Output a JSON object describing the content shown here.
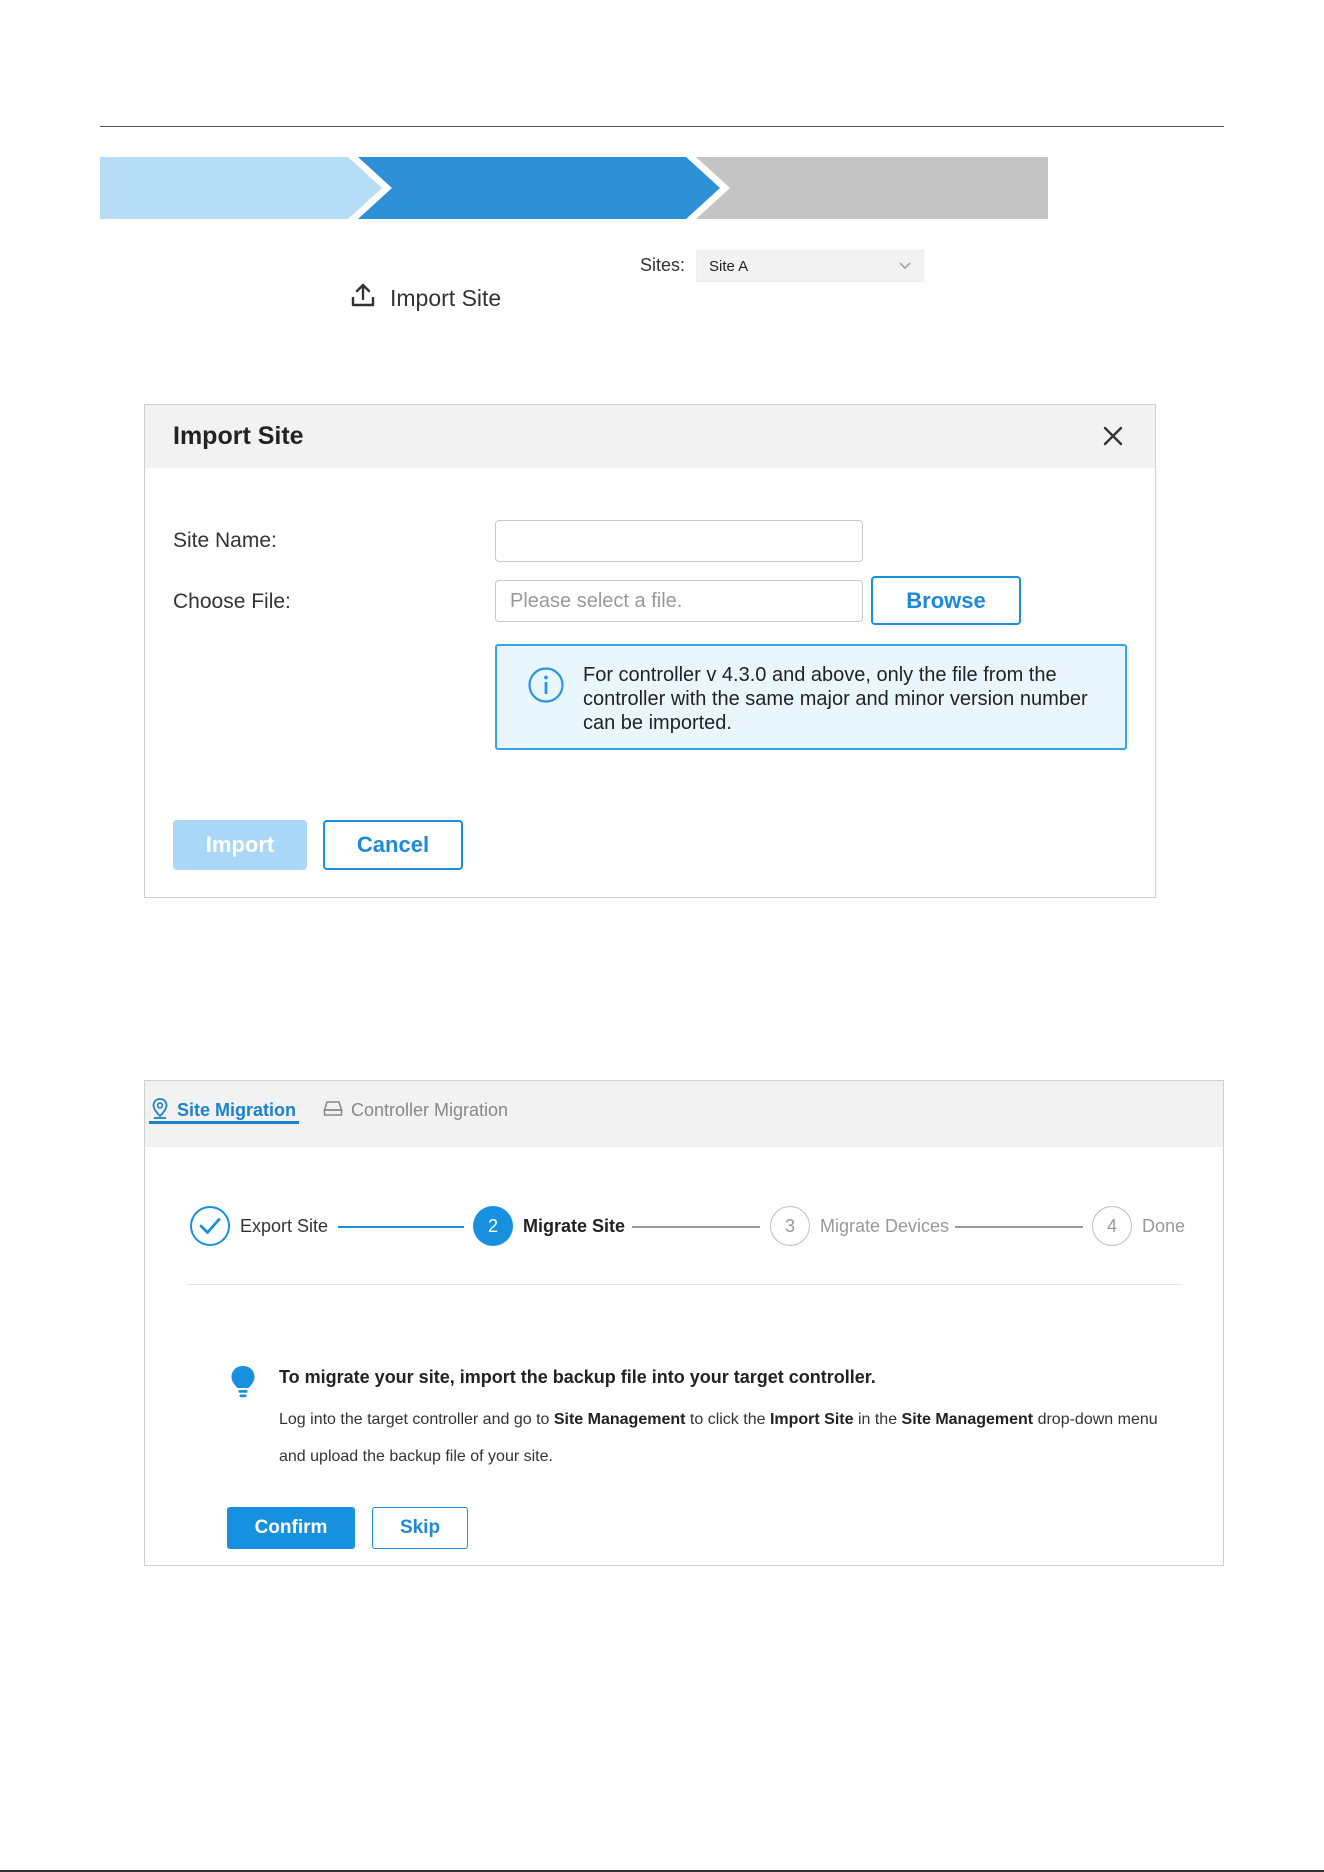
{
  "colors": {
    "primary": "#1890e0",
    "step_light": "#b7dcf6",
    "step_active": "#2d8fd6",
    "step_pending": "#c4c4c4",
    "info_bg": "#eaf6fd",
    "disabled_btn": "#a9d7f5"
  },
  "toolbar": {
    "import_site_label": "Import Site",
    "sites_label": "Sites:",
    "sites_selected": "Site A",
    "icons": {
      "import": "upload-icon",
      "dropdown": "chevron-down-icon"
    }
  },
  "import_dialog": {
    "title": "Import Site",
    "site_name_label": "Site Name:",
    "site_name_value": "",
    "choose_file_label": "Choose File:",
    "file_placeholder": "Please select a file.",
    "browse_label": "Browse",
    "info_text": "For controller v 4.3.0 and above, only the file from the controller with the same major and minor version number can be imported.",
    "import_label": "Import",
    "cancel_label": "Cancel",
    "icons": {
      "close": "close-icon",
      "info": "info-icon"
    }
  },
  "migration_panel": {
    "tabs": [
      {
        "label": "Site Migration",
        "active": true,
        "icon": "location-pin-icon"
      },
      {
        "label": "Controller Migration",
        "active": false,
        "icon": "controller-icon"
      }
    ],
    "steps": [
      {
        "number": "",
        "label": "Export Site",
        "state": "done"
      },
      {
        "number": "2",
        "label": "Migrate Site",
        "state": "active"
      },
      {
        "number": "3",
        "label": "Migrate Devices",
        "state": "pending"
      },
      {
        "number": "4",
        "label": "Done",
        "state": "pending"
      }
    ],
    "notice_title": "To migrate your site, import the backup file into your target controller.",
    "notice_body": {
      "part1": "Log into the target controller and go to ",
      "bold1": "Site Management",
      "part2": " to click the ",
      "bold2": "Import Site",
      "part3": " in the ",
      "bold3": "Site Management",
      "part4": " drop-down menu and upload the backup file of your site."
    },
    "confirm_label": "Confirm",
    "skip_label": "Skip"
  }
}
